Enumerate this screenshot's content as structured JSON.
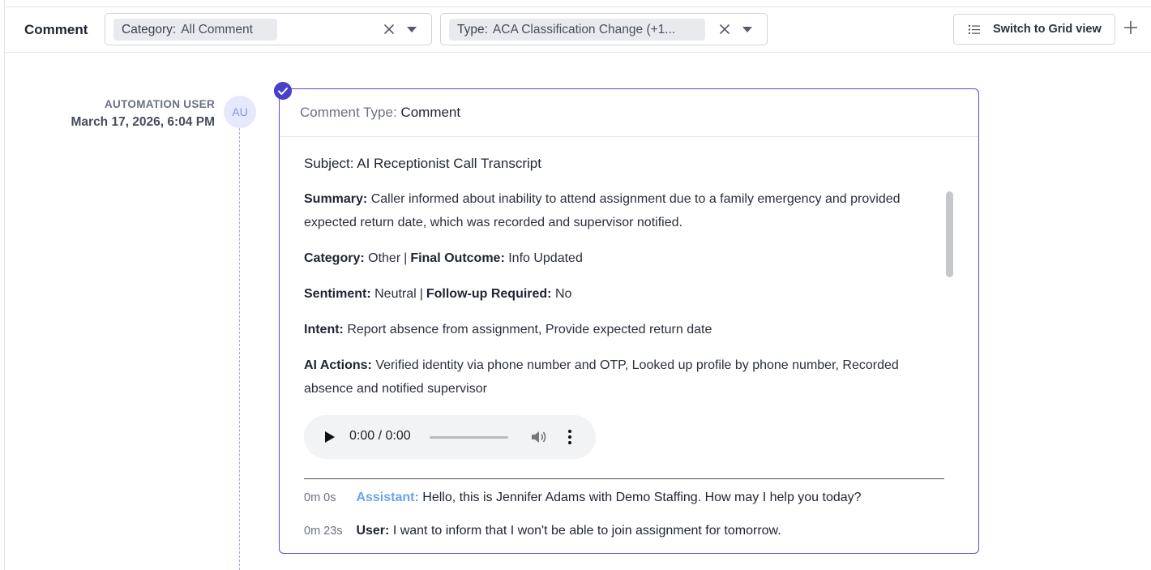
{
  "toolbar": {
    "title": "Comment",
    "category_filter": {
      "key": "Category:",
      "value": "All Comment"
    },
    "type_filter": {
      "key": "Type:",
      "value": "ACA Classification Change  (+1..."
    },
    "grid_button_label": "Switch to Grid view"
  },
  "entry": {
    "avatar_initials": "AU",
    "author": "AUTOMATION USER",
    "date": "March 17, 2026, 6:04 PM",
    "comment_type_label": "Comment Type:",
    "comment_type_value": "Comment",
    "subject_label": "Subject:",
    "subject_value": "AI Receptionist Call Transcript",
    "summary_label": "Summary:",
    "summary_value": "Caller informed about inability to attend assignment due to a family emergency and provided expected return date, which was recorded and supervisor notified.",
    "category_label": "Category:",
    "category_value": "Other",
    "outcome_label": "Final Outcome:",
    "outcome_value": "Info Updated",
    "sentiment_label": "Sentiment:",
    "sentiment_value": "Neutral",
    "followup_label": "Follow-up Required:",
    "followup_value": "No",
    "intent_label": "Intent:",
    "intent_value": "Report absence from assignment, Provide expected return date",
    "actions_label": "AI Actions:",
    "actions_value": "Verified identity via phone number and OTP, Looked up profile by phone number, Recorded absence and notified supervisor",
    "separator": "|",
    "audio": {
      "time": "0:00 / 0:00"
    },
    "transcript": [
      {
        "time": "0m 0s",
        "speaker": "Assistant:",
        "text": "Hello, this is Jennifer Adams with Demo Staffing. How may I help you today?"
      },
      {
        "time": "0m 23s",
        "speaker": "User:",
        "text": "I want to inform that I won't be able to join assignment for tomorrow."
      }
    ]
  },
  "colors": {
    "accent": "#4a3fc9",
    "card_border": "#5b4fd6",
    "assistant_speaker": "#6aa3f0",
    "avatar_bg": "#e7e8fb"
  }
}
